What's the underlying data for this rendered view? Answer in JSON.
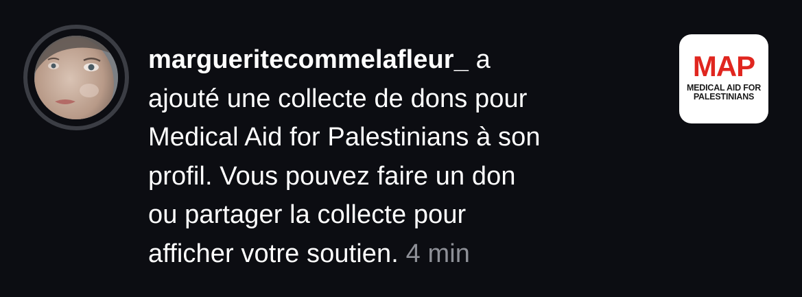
{
  "notification": {
    "username": "margueritecommelafleur_",
    "message_lines": [
      " a",
      "ajouté une collecte de dons pour",
      "Medical Aid for Palestinians à son",
      "profil. Vous pouvez faire un don",
      "ou partager la collecte pour",
      "afficher votre soutien. "
    ],
    "timestamp": "4 min",
    "avatar_icon": "user-avatar-photo",
    "logo": {
      "acronym": "MAP",
      "subtitle_line1": "MEDICAL AID FOR",
      "subtitle_line2": "PALESTINIANS",
      "accent_color": "#e0261f"
    }
  },
  "colors": {
    "background": "#0c0d12",
    "text": "#ffffff",
    "secondary_text": "#8e9097",
    "avatar_ring": "#3b3d44"
  }
}
